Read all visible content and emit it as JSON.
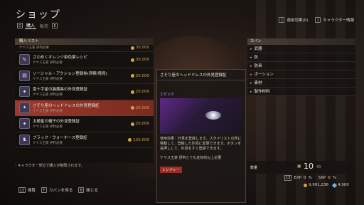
{
  "header": {
    "title": "ショップ",
    "tabs": [
      {
        "key": "Q",
        "label": "購入"
      },
      {
        "label": "販売",
        "key": "E"
      }
    ]
  },
  "top_right": [
    {
      "key": "1",
      "label": "適用効果(0)"
    },
    {
      "key": "1",
      "label": "キャラクター情報"
    }
  ],
  "list": {
    "header": "購入リスト",
    "rows": [
      {
        "name": "",
        "sub": "ケヤス王家 評判必要",
        "price": "30,000"
      },
      {
        "name": "さわめくオレンジ染色薬レシピ",
        "sub": "ケヤス王家 評判必要",
        "price": "30,000"
      },
      {
        "name": "ソーシャル・アクション登録券(洞察/発見)",
        "sub": "ケヤス王家 評判必要",
        "price": "20,000"
      },
      {
        "name": "南十字星の脳護具の外見登録証",
        "sub": "ケヤス王家 評判必要",
        "price": "20,000"
      },
      {
        "name": "さそり座のヘッドドレスの外見登録証",
        "sub": "ケヤス王家 評判必要",
        "price": "20,000"
      },
      {
        "name": "太極星の帽子の外見登録証",
        "sub": "ケヤス王家 評判必要",
        "price": "20,000"
      },
      {
        "name": "ブラック・ウォーホース登録証",
        "sub": "ケヤス王家 評判必要",
        "price": "120,000"
      }
    ],
    "selected_index": 4
  },
  "note": {
    "mark": "!",
    "text": "キャラクター単位で購入が制限されます。"
  },
  "detail": {
    "title": "さそり座のヘッドドレスの外見登録証",
    "rarity": "エピック",
    "description": "使用効果：外見を登録します。スタイリストの所に移動して、登録した外見に変更できます。ボタンを長押しして、外見をすぐ登録できます。",
    "requirement": "ケヤス王家 評判とても友好的以上必要",
    "tag": "レンジャー"
  },
  "categories": {
    "header": "カバン",
    "items": [
      "武器",
      "防",
      "防具",
      "ポーション",
      "素材",
      "製作材料"
    ]
  },
  "count": {
    "label": "数量",
    "value": "10",
    "max": "40"
  },
  "stats": {
    "level": "12",
    "exp_label": "EXP",
    "exp_value": "0",
    "sxp_label": "SXP",
    "sxp_value": "0",
    "percent": "%"
  },
  "currency": {
    "gold": "9,991,236",
    "gems": "4,900"
  },
  "footer": [
    {
      "key": "L3",
      "label": "閲覧"
    },
    {
      "key": "F",
      "label": "カバンを見る"
    },
    {
      "key": "B",
      "label": "閉じる"
    }
  ],
  "colors": {
    "selected_row": "#9b3a2c",
    "gold": "#d2a544",
    "epic": "#c39bff",
    "class_tag": "#9b2a22"
  }
}
